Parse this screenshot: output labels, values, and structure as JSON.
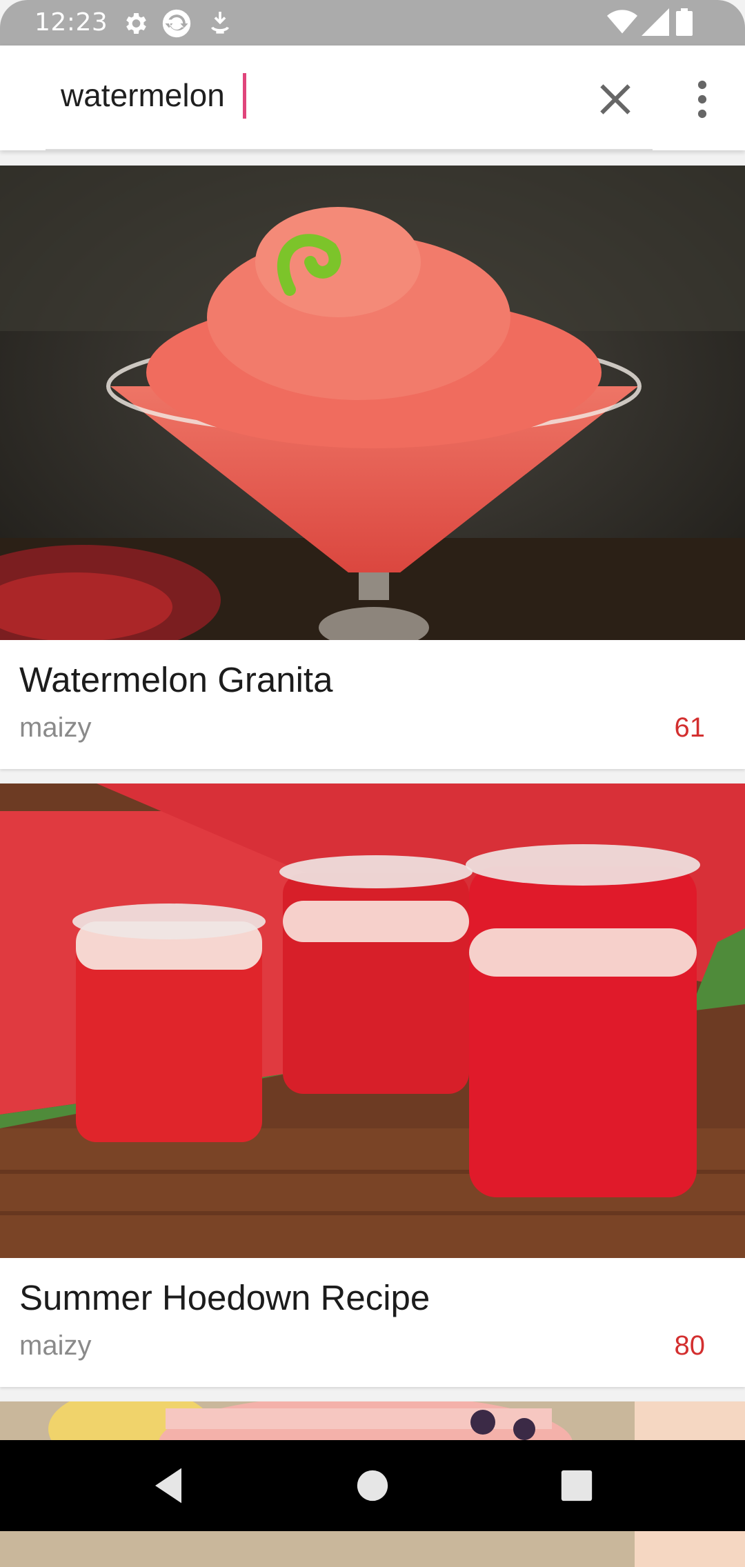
{
  "status_bar": {
    "time": "12:23",
    "icons": [
      "gear-icon",
      "sync-icon",
      "download-icon",
      "wifi-icon",
      "signal-icon",
      "battery-icon"
    ]
  },
  "search": {
    "value": "watermelon",
    "clear_icon": "close-icon",
    "menu_icon": "more-vert-icon"
  },
  "results": [
    {
      "title": "Watermelon Granita",
      "author": "maizy",
      "count": "61",
      "image": "watermelon-granita-photo"
    },
    {
      "title": "Summer Hoedown Recipe",
      "author": "maizy",
      "count": "80",
      "image": "watermelon-juice-jars-photo"
    },
    {
      "image": "partial-drink-photo"
    }
  ],
  "nav_bar": {
    "icons": [
      "back-icon",
      "home-icon",
      "recents-icon"
    ]
  },
  "colors": {
    "accent": "#e0457b",
    "count": "#d32f2f",
    "status_bar": "#ababab",
    "nav_bar": "#000000"
  }
}
